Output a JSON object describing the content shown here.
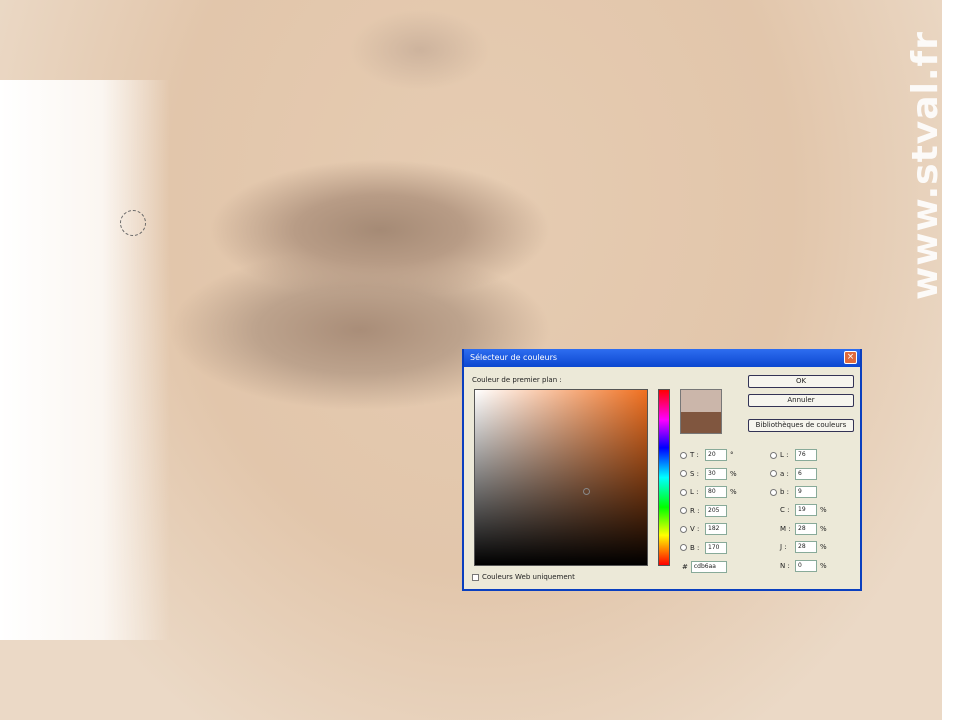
{
  "watermark": "www.stval.fr",
  "dialog": {
    "title": "Sélecteur de couleurs",
    "close": "×",
    "foreground_label": "Couleur de premier plan :",
    "ok": "OK",
    "cancel": "Annuler",
    "libraries": "Bibliothèques de couleurs",
    "web_only": "Couleurs Web uniquement",
    "new_color": "#cbb6aa",
    "old_color": "#80563f",
    "fields_left": [
      {
        "label": "T :",
        "value": "20",
        "unit": "°"
      },
      {
        "label": "S :",
        "value": "30",
        "unit": "%"
      },
      {
        "label": "L :",
        "value": "80",
        "unit": "%"
      },
      {
        "label": "R :",
        "value": "205",
        "unit": ""
      },
      {
        "label": "V :",
        "value": "182",
        "unit": ""
      },
      {
        "label": "B :",
        "value": "170",
        "unit": ""
      }
    ],
    "fields_lab": [
      {
        "label": "L :",
        "value": "76"
      },
      {
        "label": "a :",
        "value": "6"
      },
      {
        "label": "b :",
        "value": "9"
      }
    ],
    "fields_cmyk": [
      {
        "label": "C :",
        "value": "19",
        "unit": "%"
      },
      {
        "label": "M :",
        "value": "28",
        "unit": "%"
      },
      {
        "label": "J :",
        "value": "28",
        "unit": "%"
      },
      {
        "label": "N :",
        "value": "0",
        "unit": "%"
      }
    ],
    "hex_label": "#",
    "hex": "cdb6aa"
  }
}
